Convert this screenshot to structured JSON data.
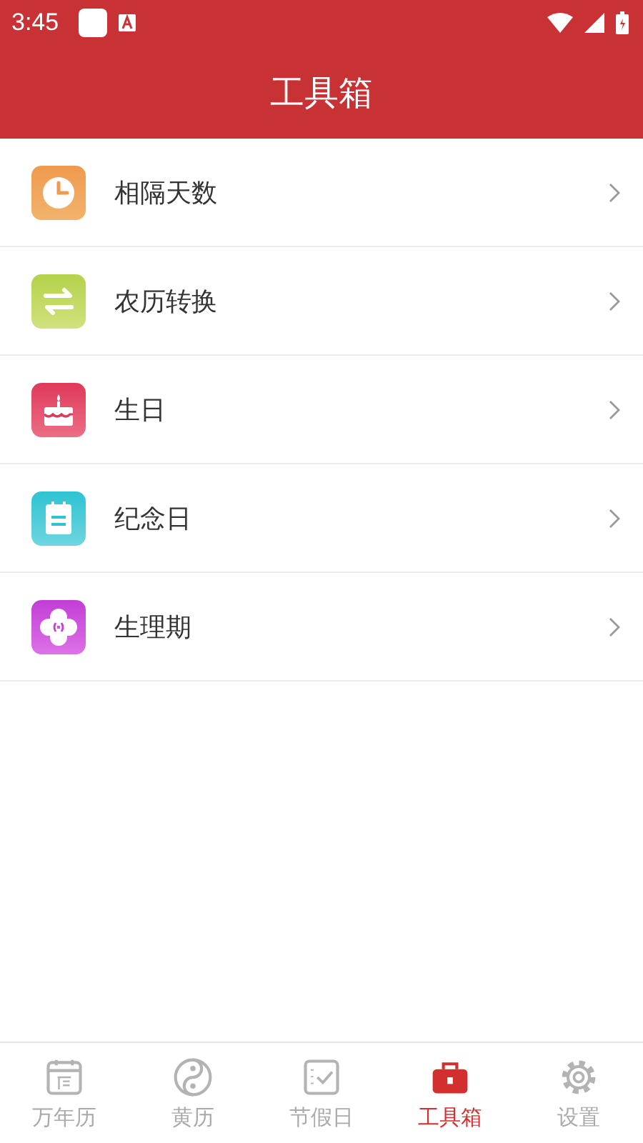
{
  "status_bar": {
    "time": "3:45"
  },
  "header": {
    "title": "工具箱"
  },
  "tools": [
    {
      "kind": "clock",
      "label": "相隔天数"
    },
    {
      "kind": "convert",
      "label": "农历转换"
    },
    {
      "kind": "cake",
      "label": "生日"
    },
    {
      "kind": "note",
      "label": "纪念日"
    },
    {
      "kind": "flower",
      "label": "生理期"
    }
  ],
  "tab_bar": [
    {
      "kind": "calendar",
      "label": "万年历",
      "selected": false
    },
    {
      "kind": "yinyang",
      "label": "黄历",
      "selected": false
    },
    {
      "kind": "check",
      "label": "节假日",
      "selected": false
    },
    {
      "kind": "toolbox",
      "label": "工具箱",
      "selected": true
    },
    {
      "kind": "gear",
      "label": "设置",
      "selected": false
    }
  ]
}
